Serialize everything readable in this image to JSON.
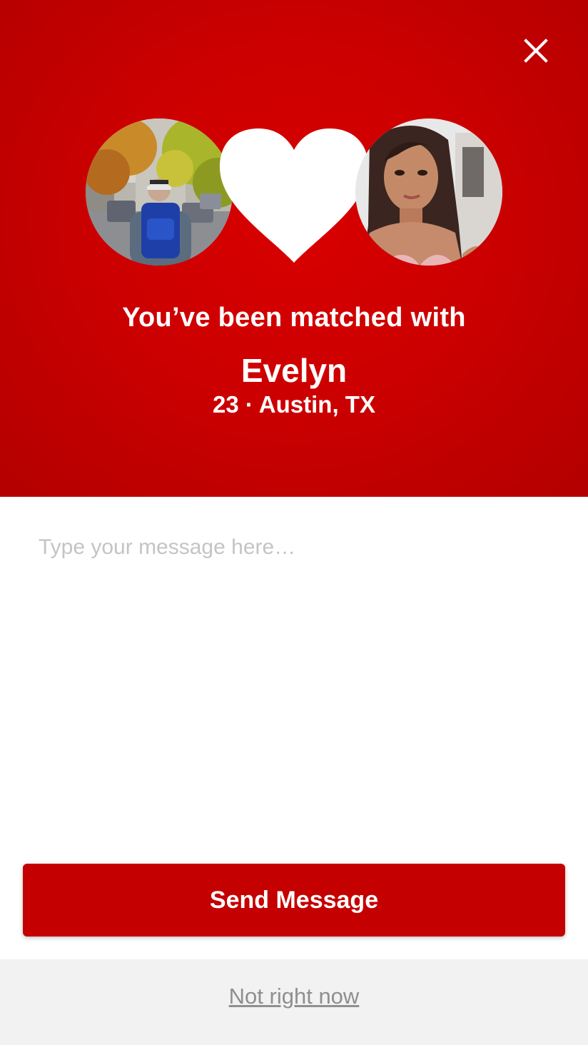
{
  "colors": {
    "brand_red": "#cc0000",
    "button_red": "#c40000",
    "panel_white": "#ffffff",
    "footer_gray": "#f2f2f2",
    "placeholder_gray": "#c4c4c4",
    "link_gray": "#8f8f8f"
  },
  "header": {
    "close_icon": "close-icon"
  },
  "avatars": {
    "left_icon": "user-photo",
    "center_icon": "heart-icon",
    "right_icon": "match-photo"
  },
  "match": {
    "headline": "You’ve been matched with",
    "name": "Evelyn",
    "details": "23 · Austin, TX"
  },
  "composer": {
    "placeholder": "Type your message here…",
    "value": "",
    "send_label": "Send Message"
  },
  "footer": {
    "dismiss_label": "Not right now"
  }
}
